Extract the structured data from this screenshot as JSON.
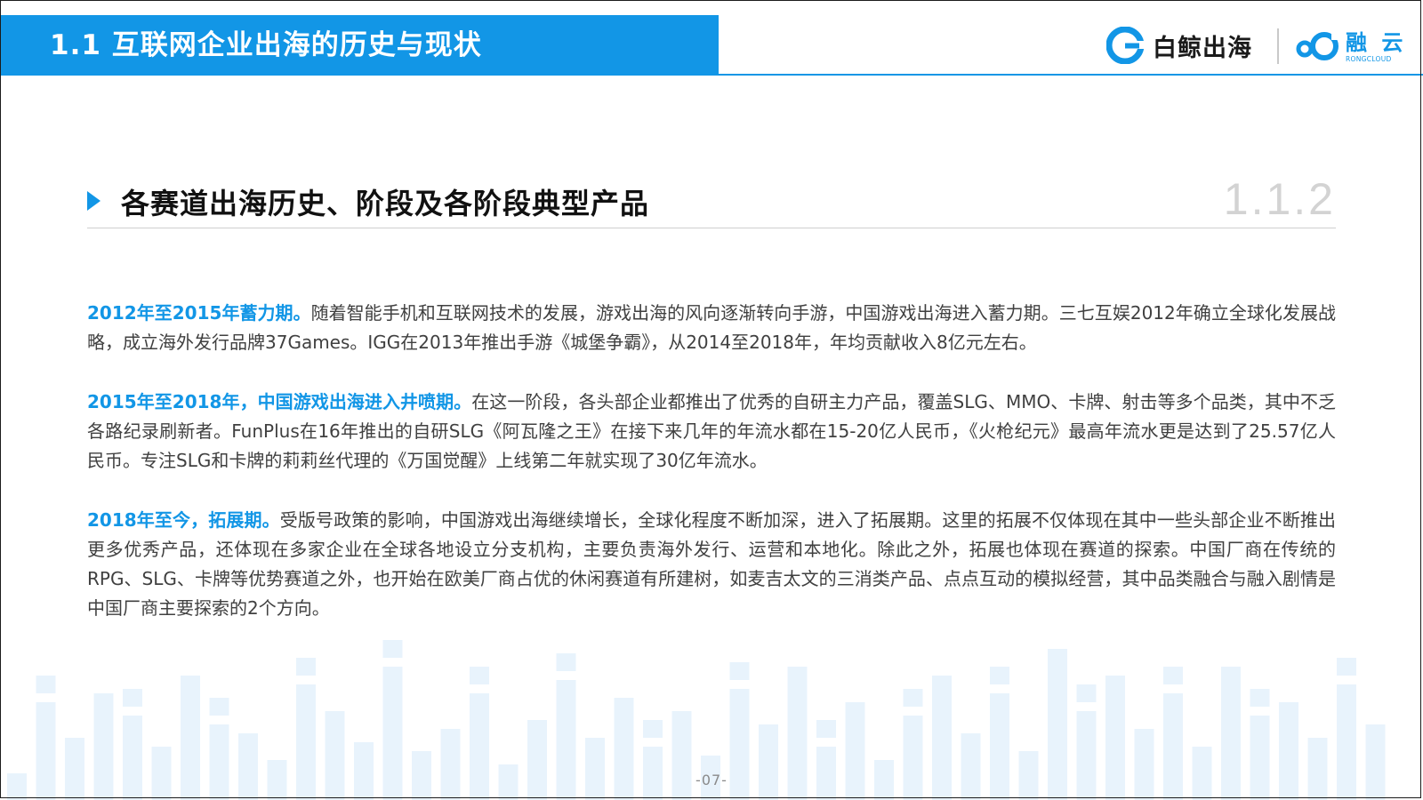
{
  "header": {
    "title": "1.1 互联网企业出海的历史与现状",
    "logo_baijing": "白鲸出海",
    "logo_rongyun_cn": "融 云",
    "logo_rongyun_en": "RONGCLOUD"
  },
  "section": {
    "title": "各赛道出海历史、阶段及各阶段典型产品",
    "number": "1.1.2"
  },
  "paragraphs": [
    {
      "lead": "2012年至2015年蓄力期。",
      "text": "随着智能手机和互联网技术的发展，游戏出海的风向逐渐转向手游，中国游戏出海进入蓄力期。三七互娱2012年确立全球化发展战略，成立海外发行品牌37Games。IGG在2013年推出手游《城堡争霸》，从2014至2018年，年均贡献收入8亿元左右。"
    },
    {
      "lead": "2015年至2018年，中国游戏出海进入井喷期。",
      "text": "在这一阶段，各头部企业都推出了优秀的自研主力产品，覆盖SLG、MMO、卡牌、射击等多个品类，其中不乏各路纪录刷新者。FunPlus在16年推出的自研SLG《阿瓦隆之王》在接下来几年的年流水都在15-20亿人民币，《火枪纪元》最高年流水更是达到了25.57亿人民币。专注SLG和卡牌的莉莉丝代理的《万国觉醒》上线第二年就实现了30亿年流水。"
    },
    {
      "lead": "2018年至今，拓展期。",
      "text": "受版号政策的影响，中国游戏出海继续增长，全球化程度不断加深，进入了拓展期。这里的拓展不仅体现在其中一些头部企业不断推出更多优秀产品，还体现在多家企业在全球各地设立分支机构，主要负责海外发行、运营和本地化。除此之外，拓展也体现在赛道的探索。中国厂商在传统的RPG、SLG、卡牌等优势赛道之外，也开始在欧美厂商占优的休闲赛道有所建树，如麦吉太文的三消类产品、点点互动的模拟经营，其中品类融合与融入剧情是中国厂商主要探索的2个方向。"
    }
  ],
  "footer": {
    "page_number": "-07-"
  },
  "colors": {
    "accent": "#1296e6",
    "lead_text": "#1296e6",
    "body_text": "#404040",
    "decor_bars": "#e8f3fc"
  },
  "icons": [
    "baijing-logo-icon",
    "rongcloud-logo-icon",
    "section-arrow-icon"
  ]
}
